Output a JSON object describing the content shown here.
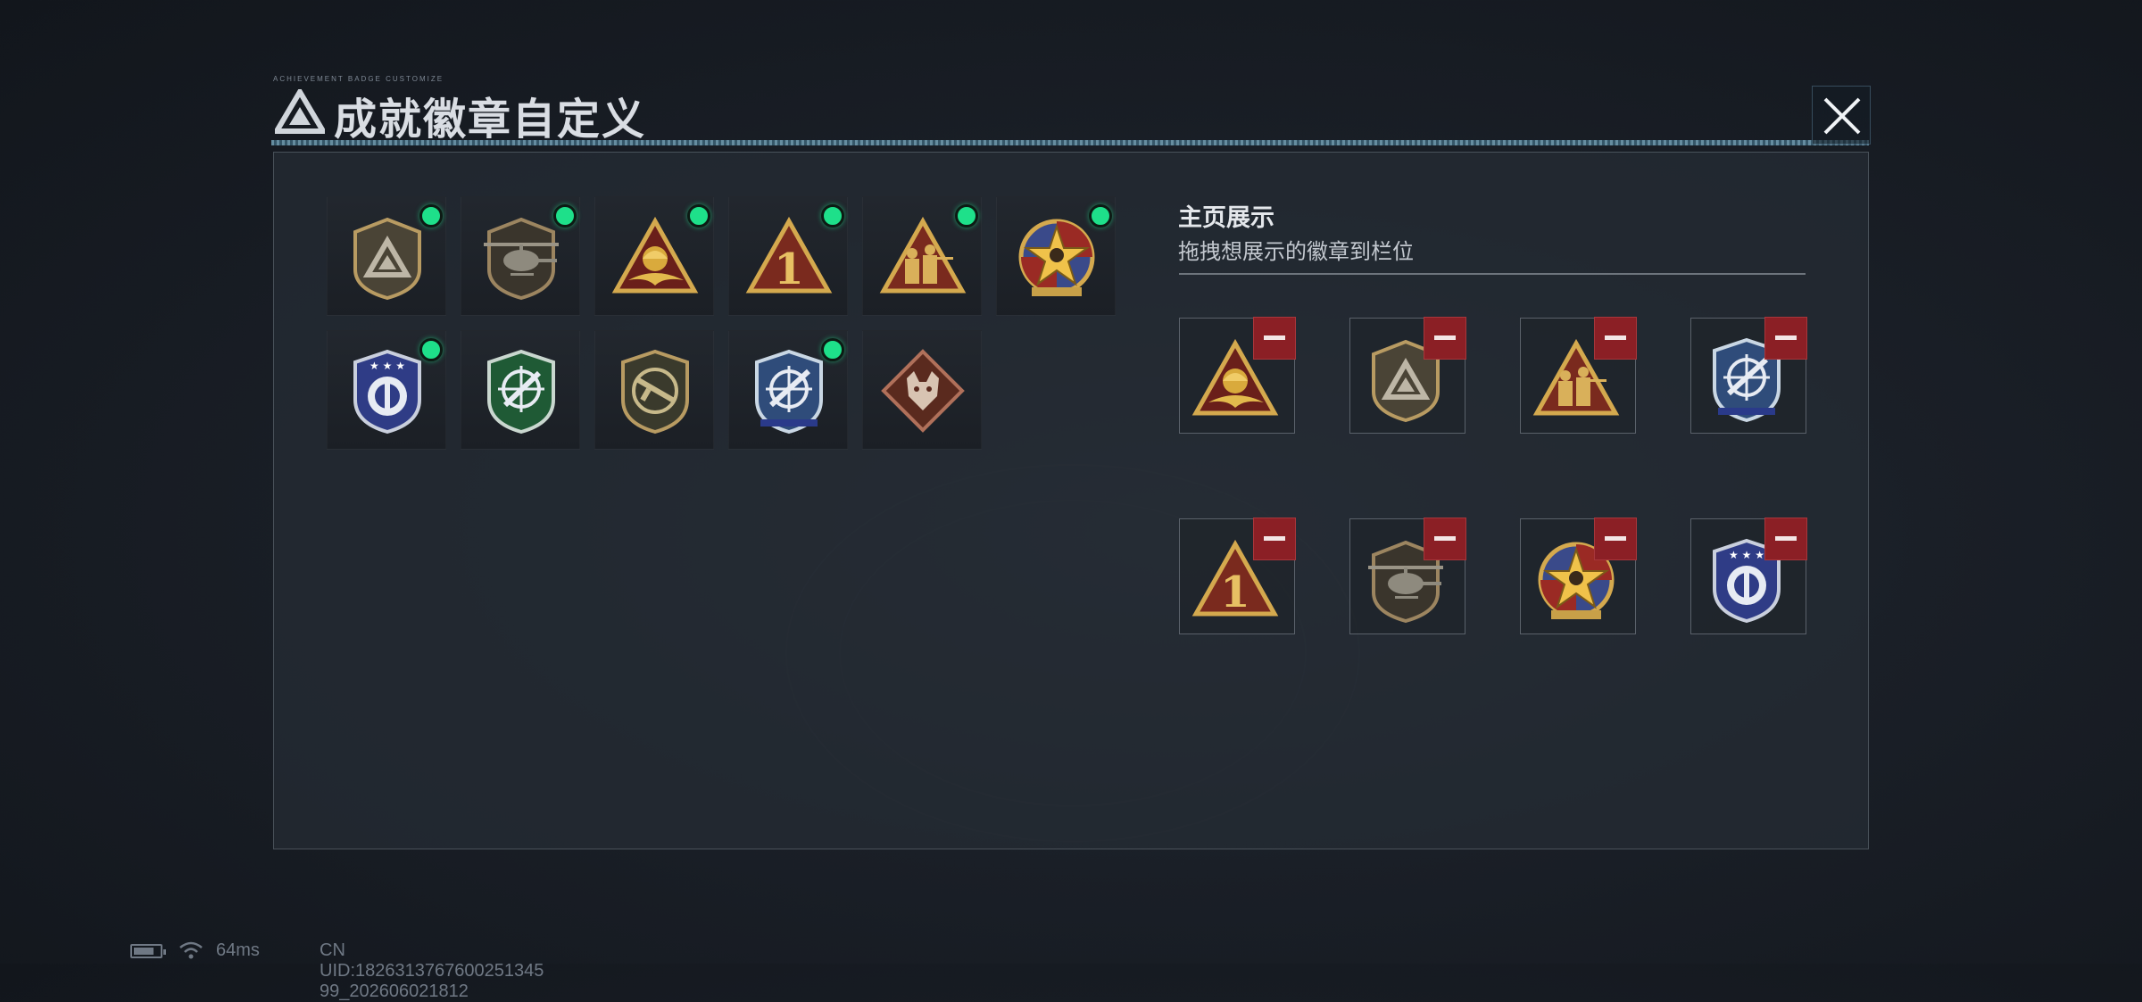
{
  "window": {
    "title": "成就徽章自定义",
    "title_small": "ACHIEVEMENT BADGE CUSTOMIZE",
    "close_icon": "close-icon"
  },
  "collection": {
    "badges": [
      {
        "name": "tri-emblem-badge",
        "equipped": true
      },
      {
        "name": "helicopter-badge",
        "equipped": true
      },
      {
        "name": "eagle-triangle-badge",
        "equipped": true
      },
      {
        "name": "number-one-badge",
        "equipped": true
      },
      {
        "name": "squad-triangle-badge",
        "equipped": true
      },
      {
        "name": "star-medal-badge",
        "equipped": true
      },
      {
        "name": "blue-shield-badge",
        "equipped": true
      },
      {
        "name": "green-crosshair-badge",
        "equipped": false
      },
      {
        "name": "rifle-shield-badge",
        "equipped": false
      },
      {
        "name": "blue-crosshair-badge",
        "equipped": true
      },
      {
        "name": "wolf-diamond-badge",
        "equipped": false
      }
    ]
  },
  "showcase": {
    "title": "主页展示",
    "subtitle": "拖拽想展示的徽章到栏位",
    "slots": [
      "eagle-triangle-badge",
      "tri-emblem-badge",
      "squad-triangle-badge",
      "blue-crosshair-badge",
      "number-one-badge",
      "helicopter-badge",
      "star-medal-badge",
      "blue-shield-badge"
    ],
    "remove_icon": "minus-icon"
  },
  "status": {
    "ping": "64ms",
    "uid": "CN UID:1826313767600251345​99_202606021812"
  },
  "colors": {
    "equipped_dot": "#1ee08a",
    "remove_button": "#8b1f25",
    "accent_line": "#7fb2c9"
  }
}
